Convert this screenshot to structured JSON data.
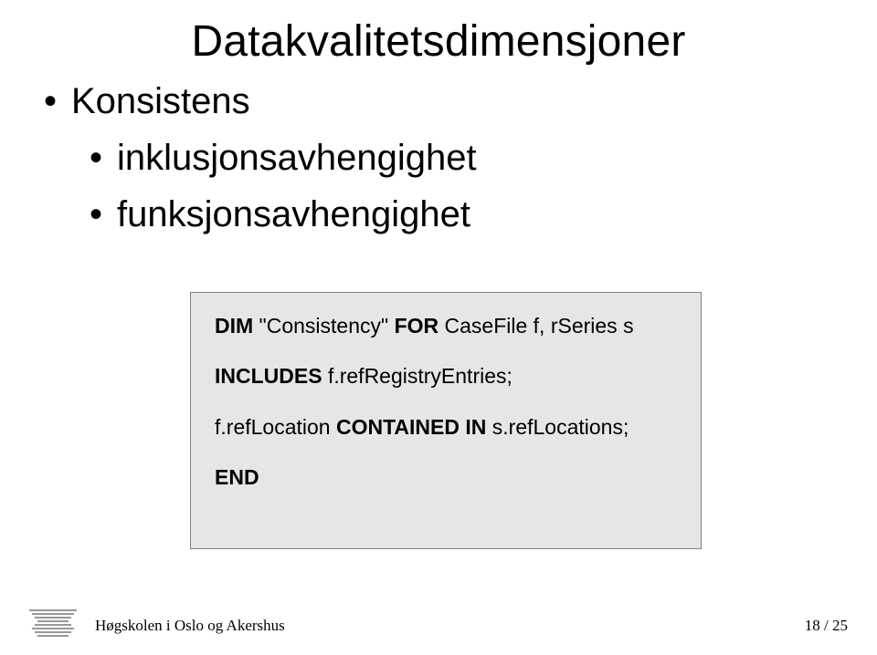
{
  "title": "Datakvalitetsdimensjoner",
  "bullets": {
    "b1": "Konsistens",
    "b2a": "inklusjonsavhengighet",
    "b2b": "funksjonsavhengighet"
  },
  "code": {
    "kw_dim": "DIM",
    "dim_rest": " \"Consistency\" ",
    "kw_for": "FOR",
    "for_rest": " CaseFile f, rSeries s",
    "kw_includes": "INCLUDES",
    "includes_rest": " f.refRegistryEntries;",
    "line3_a": "f.refLocation ",
    "kw_contained": "CONTAINED IN",
    "line3_b": " s.refLocations;",
    "kw_end": "END"
  },
  "footer": "Høgskolen i Oslo og Akershus",
  "page": "18 / 25"
}
